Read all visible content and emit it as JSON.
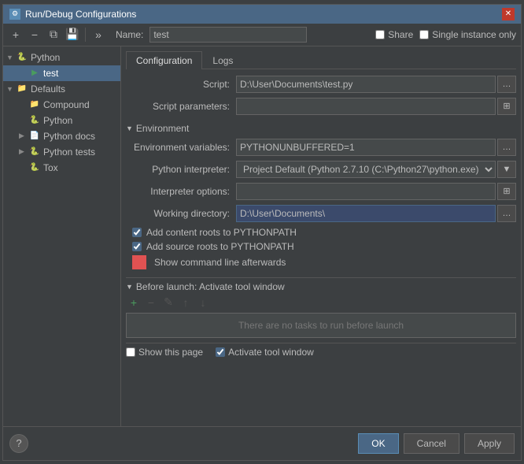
{
  "dialog": {
    "title": "Run/Debug Configurations",
    "close_label": "✕"
  },
  "toolbar": {
    "add_label": "+",
    "remove_label": "−",
    "copy_label": "⧉",
    "save_label": "💾",
    "more_label": "»"
  },
  "name_row": {
    "label": "Name:",
    "value": "test",
    "share_label": "Share",
    "single_instance_label": "Single instance only"
  },
  "sidebar": {
    "items": [
      {
        "id": "python-root",
        "label": "Python",
        "indent": 0,
        "arrow": "▼",
        "icon": "🐍",
        "selected": false
      },
      {
        "id": "test",
        "label": "test",
        "indent": 1,
        "arrow": "",
        "icon": "▶",
        "selected": true
      },
      {
        "id": "defaults",
        "label": "Defaults",
        "indent": 0,
        "arrow": "▼",
        "icon": "📁",
        "selected": false
      },
      {
        "id": "compound",
        "label": "Compound",
        "indent": 1,
        "arrow": "",
        "icon": "📁",
        "selected": false
      },
      {
        "id": "python",
        "label": "Python",
        "indent": 1,
        "arrow": "",
        "icon": "🐍",
        "selected": false
      },
      {
        "id": "python-docs",
        "label": "Python docs",
        "indent": 1,
        "arrow": "▶",
        "icon": "📄",
        "selected": false
      },
      {
        "id": "python-tests",
        "label": "Python tests",
        "indent": 1,
        "arrow": "▶",
        "icon": "🐍",
        "selected": false
      },
      {
        "id": "tox",
        "label": "Tox",
        "indent": 1,
        "arrow": "",
        "icon": "🐍",
        "selected": false
      }
    ]
  },
  "tabs": [
    {
      "id": "configuration",
      "label": "Configuration",
      "active": true
    },
    {
      "id": "logs",
      "label": "Logs",
      "active": false
    }
  ],
  "configuration": {
    "script_label": "Script:",
    "script_value": "D:\\User\\Documents\\test.py",
    "script_params_label": "Script parameters:",
    "script_params_value": "",
    "environment_section": "Environment",
    "env_vars_label": "Environment variables:",
    "env_vars_value": "PYTHONUNBUFFERED=1",
    "interpreter_label": "Python interpreter:",
    "interpreter_value": "Project Default (Python 2.7.10 (C:\\Python27\\python.exe)",
    "interp_options_label": "Interpreter options:",
    "interp_options_value": "",
    "working_dir_label": "Working directory:",
    "working_dir_value": "D:\\User\\Documents\\",
    "add_content_roots_label": "Add content roots to PYTHONPATH",
    "add_content_roots_checked": true,
    "add_source_roots_label": "Add source roots to PYTHONPATH",
    "add_source_roots_checked": true,
    "show_cmdline_label": "Show command line afterwards",
    "show_cmdline_checked": false
  },
  "before_launch": {
    "header": "Before launch: Activate tool window",
    "no_tasks_label": "There are no tasks to run before launch",
    "add_label": "+",
    "remove_label": "−",
    "edit_label": "✎",
    "up_label": "↑",
    "down_label": "↓"
  },
  "footer": {
    "show_page_label": "Show this page",
    "show_page_checked": false,
    "activate_window_label": "Activate tool window",
    "activate_window_checked": true,
    "ok_label": "OK",
    "cancel_label": "Cancel",
    "apply_label": "Apply",
    "help_label": "?"
  }
}
